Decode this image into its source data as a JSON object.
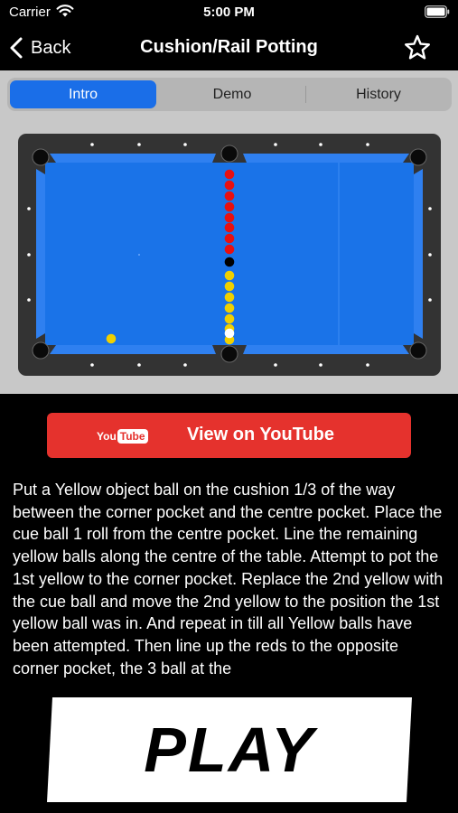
{
  "status_bar": {
    "carrier": "Carrier",
    "time": "5:00 PM"
  },
  "nav": {
    "back_label": "Back",
    "title": "Cushion/Rail Potting"
  },
  "tabs": [
    {
      "label": "Intro",
      "active": true
    },
    {
      "label": "Demo",
      "active": false
    },
    {
      "label": "History",
      "active": false
    }
  ],
  "youtube": {
    "logo_you": "You",
    "logo_tube": "Tube",
    "label": "View on YouTube"
  },
  "description": "Put a Yellow object ball on the cushion 1/3 of the way between the corner pocket and the centre pocket. Place the cue ball 1 roll from the centre pocket. Line the remaining yellow balls along the centre of the table. Attempt to pot the 1st yellow to the corner pocket. Replace the 2nd yellow with the cue ball and move the 2nd yellow to the position the 1st yellow ball was in. And repeat in till all Yellow balls have been attempted. Then line up the reds to the opposite corner pocket, the 3 ball at the",
  "play_label": "PLAY",
  "colors": {
    "accent": "#1a6ee8",
    "youtube_red": "#e5322d",
    "felt": "#1a73e8",
    "red_ball": "#e81010",
    "yellow_ball": "#f0d000",
    "black_ball": "#000000",
    "cue_ball": "#ffffff"
  },
  "table": {
    "red_balls": 8,
    "black_balls": 1,
    "yellow_balls": 8,
    "cue_balls": 1,
    "object_ball": "yellow"
  }
}
